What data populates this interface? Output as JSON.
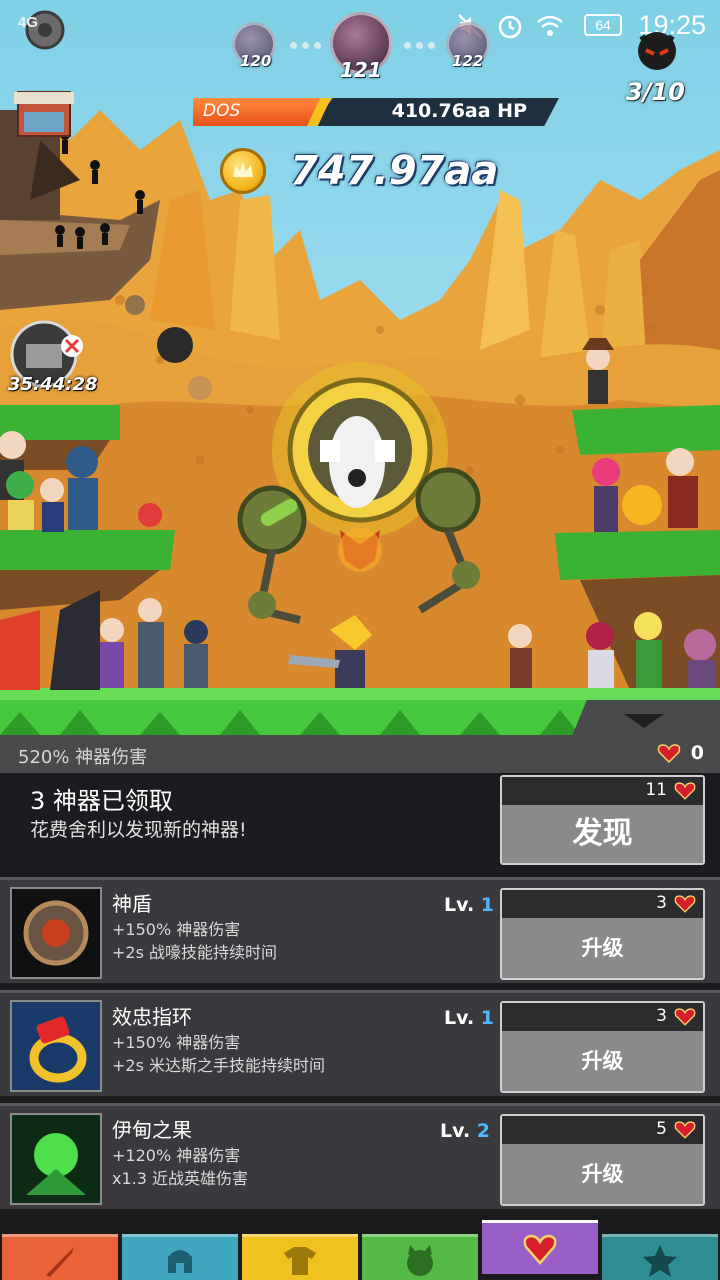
{
  "status_bar": {
    "network": "4G",
    "battery": "64",
    "time": "19:25"
  },
  "stages": {
    "prev": "120",
    "current": "121",
    "next": "122"
  },
  "boss": {
    "name": "DOS",
    "hp": "410.76aa HP",
    "hp_fraction": 0.38
  },
  "gold": "747.97aa",
  "wave": "3/10",
  "fairy_timer": "35:44:28",
  "artifact_panel": {
    "damage_bonus": "520% 神器伤害",
    "relics": "0",
    "discover": {
      "title": "3 神器已领取",
      "description": "花费舍利以发现新的神器!",
      "cost": "11",
      "button": "发现"
    },
    "artifacts": [
      {
        "name": "神盾",
        "effect1": "+150% 神器伤害",
        "effect2": "+2s 战嚎技能持续时间",
        "level_prefix": "Lv.",
        "level": "1",
        "cost": "3",
        "button": "升级"
      },
      {
        "name": "效忠指环",
        "effect1": "+150% 神器伤害",
        "effect2": "+2s 米达斯之手技能持续时间",
        "level_prefix": "Lv.",
        "level": "1",
        "cost": "3",
        "button": "升级"
      },
      {
        "name": "伊甸之果",
        "effect1": "+120% 神器伤害",
        "effect2": "x1.3 近战英雄伤害",
        "level_prefix": "Lv.",
        "level": "2",
        "cost": "5",
        "button": "升级"
      }
    ]
  },
  "tabs": [
    {
      "icon": "sword-icon",
      "color": "#e8633a"
    },
    {
      "icon": "helmet-icon",
      "color": "#3fa6bd"
    },
    {
      "icon": "shirt-icon",
      "color": "#f0c21f"
    },
    {
      "icon": "pet-icon",
      "color": "#55b947"
    },
    {
      "icon": "winged-heart-icon",
      "color": "#9a5ec9"
    },
    {
      "icon": "star-icon",
      "color": "#2e8d92"
    }
  ]
}
